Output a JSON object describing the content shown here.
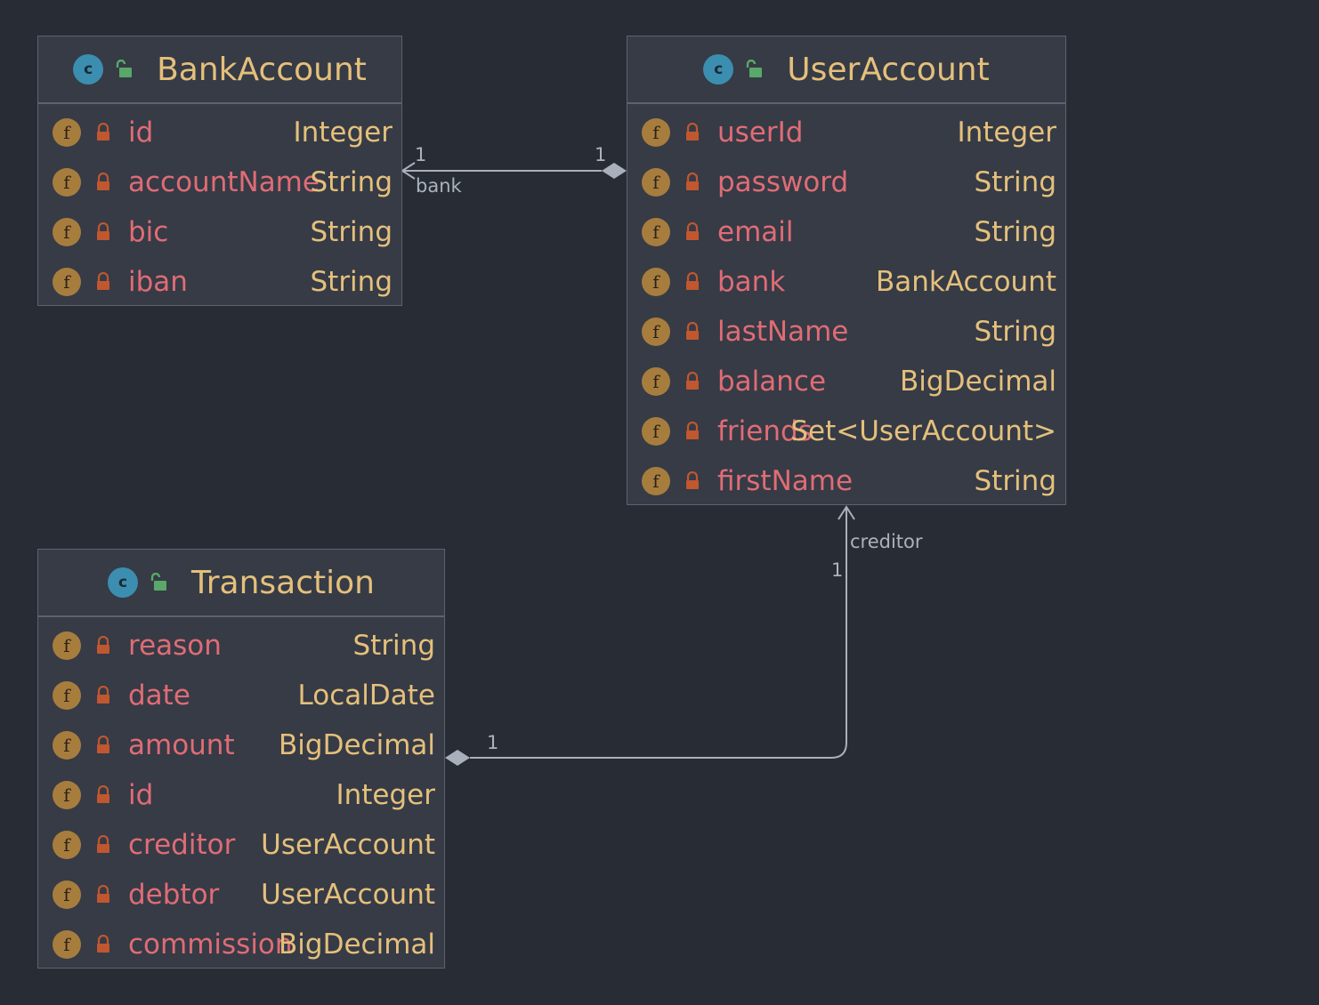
{
  "classes": {
    "bank_account": {
      "name": "BankAccount",
      "fields": [
        {
          "name": "id",
          "type": "Integer"
        },
        {
          "name": "accountName",
          "type": "String"
        },
        {
          "name": "bic",
          "type": "String"
        },
        {
          "name": "iban",
          "type": "String"
        }
      ]
    },
    "user_account": {
      "name": "UserAccount",
      "fields": [
        {
          "name": "userId",
          "type": "Integer"
        },
        {
          "name": "password",
          "type": "String"
        },
        {
          "name": "email",
          "type": "String"
        },
        {
          "name": "bank",
          "type": "BankAccount"
        },
        {
          "name": "lastName",
          "type": "String"
        },
        {
          "name": "balance",
          "type": "BigDecimal"
        },
        {
          "name": "friends",
          "type": "Set<UserAccount>"
        },
        {
          "name": "firstName",
          "type": "String"
        }
      ]
    },
    "transaction": {
      "name": "Transaction",
      "fields": [
        {
          "name": "reason",
          "type": "String"
        },
        {
          "name": "date",
          "type": "LocalDate"
        },
        {
          "name": "amount",
          "type": "BigDecimal"
        },
        {
          "name": "id",
          "type": "Integer"
        },
        {
          "name": "creditor",
          "type": "UserAccount"
        },
        {
          "name": "debtor",
          "type": "UserAccount"
        },
        {
          "name": "commission",
          "type": "BigDecimal"
        }
      ]
    }
  },
  "icons": {
    "class": "class-c-icon",
    "visibility": "open-lock-icon",
    "field": "field-f-icon",
    "private": "lock-icon",
    "class_letter": "c",
    "field_letter": "f"
  },
  "relations": {
    "bank": {
      "role": "bank",
      "source_multiplicity": "1",
      "target_multiplicity": "1"
    },
    "creditor": {
      "role": "creditor",
      "target_multiplicity": "1",
      "source_multiplicity": "1"
    }
  },
  "colors": {
    "background": "#282c34",
    "class_name": "#e5c07b",
    "field_name": "#e06c75",
    "field_type": "#e5c07b",
    "line": "#aab0bb"
  }
}
